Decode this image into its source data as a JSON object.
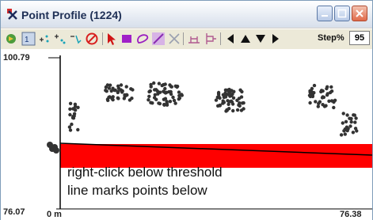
{
  "window": {
    "title": "Point Profile (1224)",
    "controls": [
      "minimize",
      "maximize",
      "close"
    ]
  },
  "toolbar": {
    "step_label": "Step%",
    "step_value": "95",
    "icons": [
      "globe-icon",
      "select-points-icon",
      "add-point-icon",
      "add-points-icon",
      "remove-points-icon",
      "cancel-icon",
      "pointer-icon",
      "rectangle-icon",
      "lasso-icon",
      "line-icon",
      "clear-icon",
      "threshold-icon",
      "profile-icon",
      "arrow-left-icon",
      "arrow-up-icon",
      "arrow-down-icon",
      "arrow-right-icon"
    ]
  },
  "plot": {
    "y_max_label": "100.79",
    "y_min_label": "76.07",
    "x_min_label": "0 m",
    "x_max_label": "76.38",
    "annotation_line1": "right-click below threshold",
    "annotation_line2": "line marks points below"
  },
  "colors": {
    "marked_points": "#ff0000",
    "points": "#333333",
    "threshold_line": "#000000"
  }
}
